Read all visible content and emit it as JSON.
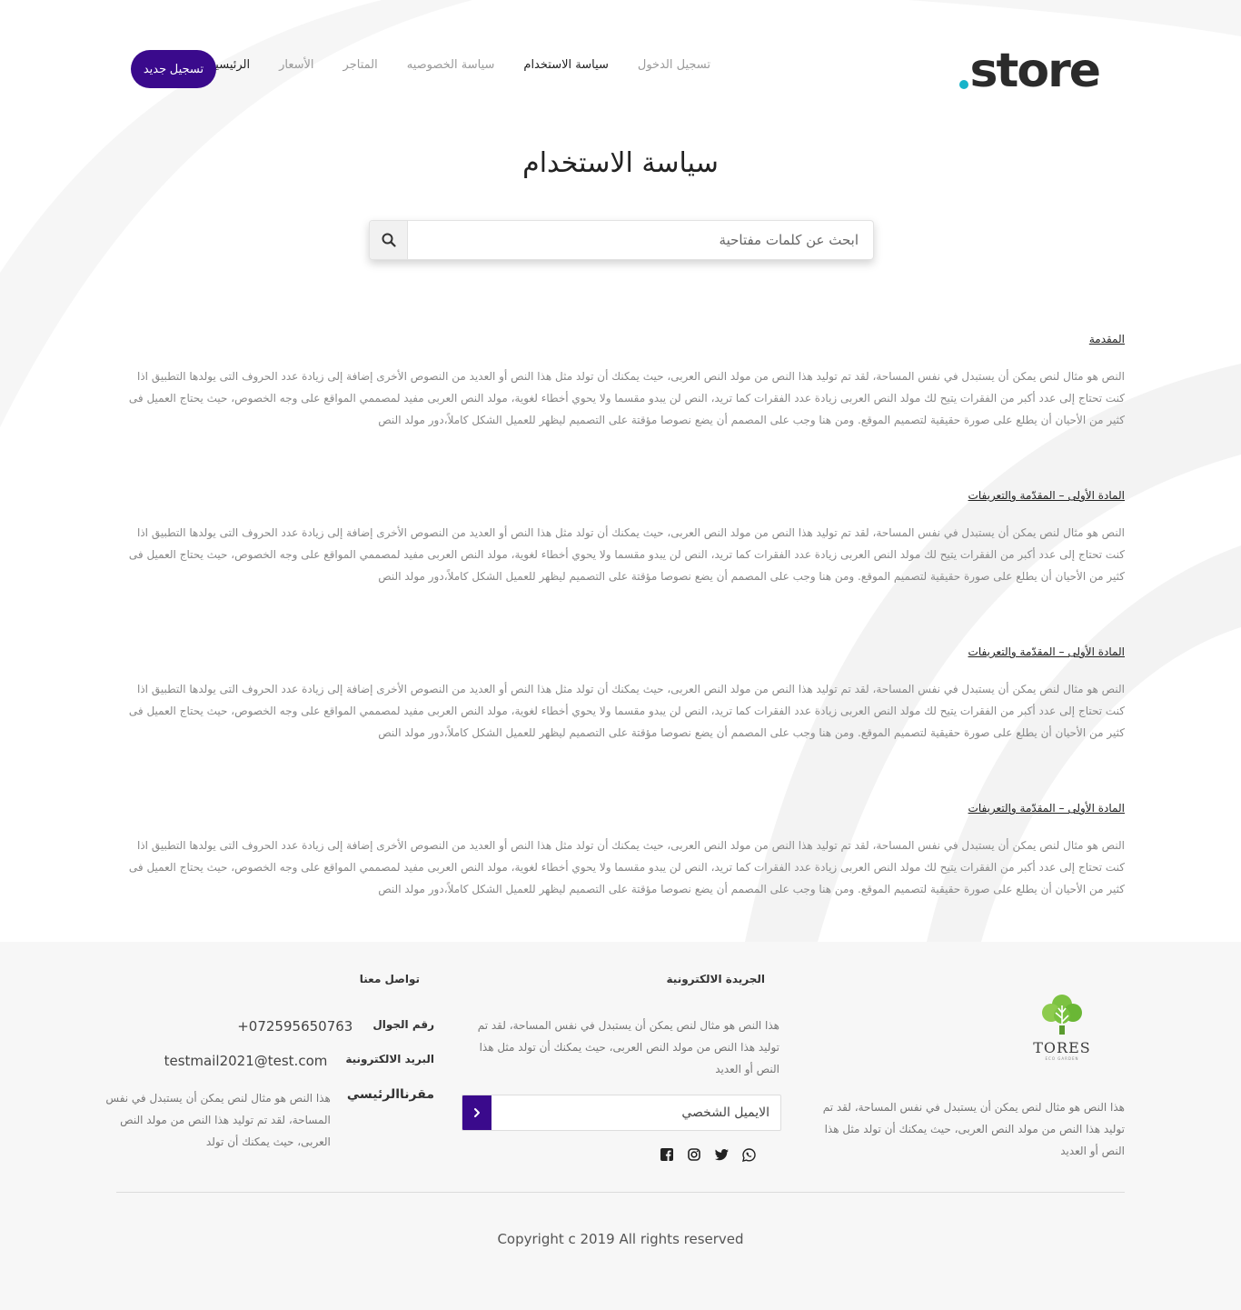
{
  "header": {
    "logo_text": "store",
    "nav": [
      {
        "label": "الرئيسية",
        "active": true
      },
      {
        "label": "الأسعار",
        "active": false
      },
      {
        "label": "المتاجر",
        "active": false
      },
      {
        "label": "سياسة الخصوصيه",
        "active": false
      },
      {
        "label": "سياسة الاستخدام",
        "active": true
      },
      {
        "label": "تسجيل الدخول",
        "active": false
      }
    ],
    "signup_label": "تسجيل جديد"
  },
  "page_title": "سياسة الاستخدام",
  "search": {
    "placeholder": "ابحث عن كلمات مفتاحية",
    "icon": "search-icon"
  },
  "sections": [
    {
      "heading": "المقدمة",
      "body": "النص هو مثال لنص يمكن أن يستبدل في نفس المساحة، لقد تم توليد هذا النص من مولد النص العربى، حيث يمكنك أن تولد مثل هذا النص أو العديد من النصوص الأخرى إضافة إلى زيادة عدد الحروف التى يولدها التطبيق اذا كنت تحتاج إلى عدد أكبر من الفقرات يتيح لك مولد النص العربى زيادة عدد الفقرات كما تريد، النص لن يبدو مقسما ولا يحوي أخطاء لغوية، مولد النص العربى مفيد لمصممي المواقع على وجه الخصوص، حيث يحتاج العميل فى كثير من الأحيان أن يطلع على صورة حقيقية لتصميم الموقع. ومن هنا وجب على المصمم أن يضع نصوصا مؤقتة على التصميم ليظهر للعميل الشكل كاملاً،دور مولد النص"
    },
    {
      "heading": "المادة الأولى – المقدّمة والتعريفات",
      "body": "النص هو مثال لنص يمكن أن يستبدل في نفس المساحة، لقد تم توليد هذا النص من مولد النص العربى، حيث يمكنك أن تولد مثل هذا النص أو العديد من النصوص الأخرى إضافة إلى زيادة عدد الحروف التى يولدها التطبيق اذا كنت تحتاج إلى عدد أكبر من الفقرات يتيح لك مولد النص العربى زيادة عدد الفقرات كما تريد، النص لن يبدو مقسما ولا يحوي أخطاء لغوية، مولد النص العربى مفيد لمصممي المواقع على وجه الخصوص، حيث يحتاج العميل فى كثير من الأحيان أن يطلع على صورة حقيقية لتصميم الموقع. ومن هنا وجب على المصمم أن يضع نصوصا مؤقتة على التصميم ليظهر للعميل الشكل كاملاً،دور مولد النص"
    },
    {
      "heading": "المادة الأولى – المقدّمة والتعريفات",
      "body": "النص هو مثال لنص يمكن أن يستبدل في نفس المساحة، لقد تم توليد هذا النص من مولد النص العربى، حيث يمكنك أن تولد مثل هذا النص أو العديد من النصوص الأخرى إضافة إلى زيادة عدد الحروف التى يولدها التطبيق اذا كنت تحتاج إلى عدد أكبر من الفقرات يتيح لك مولد النص العربى زيادة عدد الفقرات كما تريد، النص لن يبدو مقسما ولا يحوي أخطاء لغوية، مولد النص العربى مفيد لمصممي المواقع على وجه الخصوص، حيث يحتاج العميل فى كثير من الأحيان أن يطلع على صورة حقيقية لتصميم الموقع. ومن هنا وجب على المصمم أن يضع نصوصا مؤقتة على التصميم ليظهر للعميل الشكل كاملاً،دور مولد النص"
    },
    {
      "heading": "المادة الأولى – المقدّمة والتعريفات",
      "body": "النص هو مثال لنص يمكن أن يستبدل في نفس المساحة، لقد تم توليد هذا النص من مولد النص العربى، حيث يمكنك أن تولد مثل هذا النص أو العديد من النصوص الأخرى إضافة إلى زيادة عدد الحروف التى يولدها التطبيق اذا كنت تحتاج إلى عدد أكبر من الفقرات يتيح لك مولد النص العربى زيادة عدد الفقرات كما تريد، النص لن يبدو مقسما ولا يحوي أخطاء لغوية، مولد النص العربى مفيد لمصممي المواقع على وجه الخصوص، حيث يحتاج العميل فى كثير من الأحيان أن يطلع على صورة حقيقية لتصميم الموقع. ومن هنا وجب على المصمم أن يضع نصوصا مؤقتة على التصميم ليظهر للعميل الشكل كاملاً،دور مولد النص"
    }
  ],
  "footer": {
    "brand_name": "TORES",
    "brand_sub": "ECO GARDEN",
    "about": "هذا النص هو مثال لنص يمكن أن يستبدل في نفس المساحة، لقد تم توليد هذا النص من مولد النص العربى، حيث يمكنك أن تولد مثل هذا النص أو العديد",
    "newsletter": {
      "heading": "الجريدة الالكترونية",
      "text": "هذا النص هو مثال لنص يمكن أن يستبدل في نفس المساحة، لقد تم توليد هذا النص من مولد النص العربى، حيث يمكنك أن تولد مثل هذا النص أو العديد",
      "email_placeholder": "الايميل الشخصي"
    },
    "social": [
      "facebook-icon",
      "instagram-icon",
      "twitter-icon",
      "whatsapp-icon"
    ],
    "contact": {
      "heading": "تواصل معنا",
      "phone_label": "رقم الجوال",
      "phone": "+072595650763",
      "email_label": "البريد الالكترونية",
      "email": "testmail2021@test.com",
      "hq_label": "مقرناالرئيسي",
      "hq_text": "هذا النص هو مثال لنص يمكن أن يستبدل في نفس المساحة، لقد تم توليد هذا النص من مولد النص العربى، حيث يمكنك أن تولد"
    },
    "copyright": "Copyright c 2019 All rights reserved"
  },
  "colors": {
    "brand_purple": "#3a0a8c",
    "logo_dot": "#17b3c9",
    "footer_bg": "#f7f7f7"
  }
}
